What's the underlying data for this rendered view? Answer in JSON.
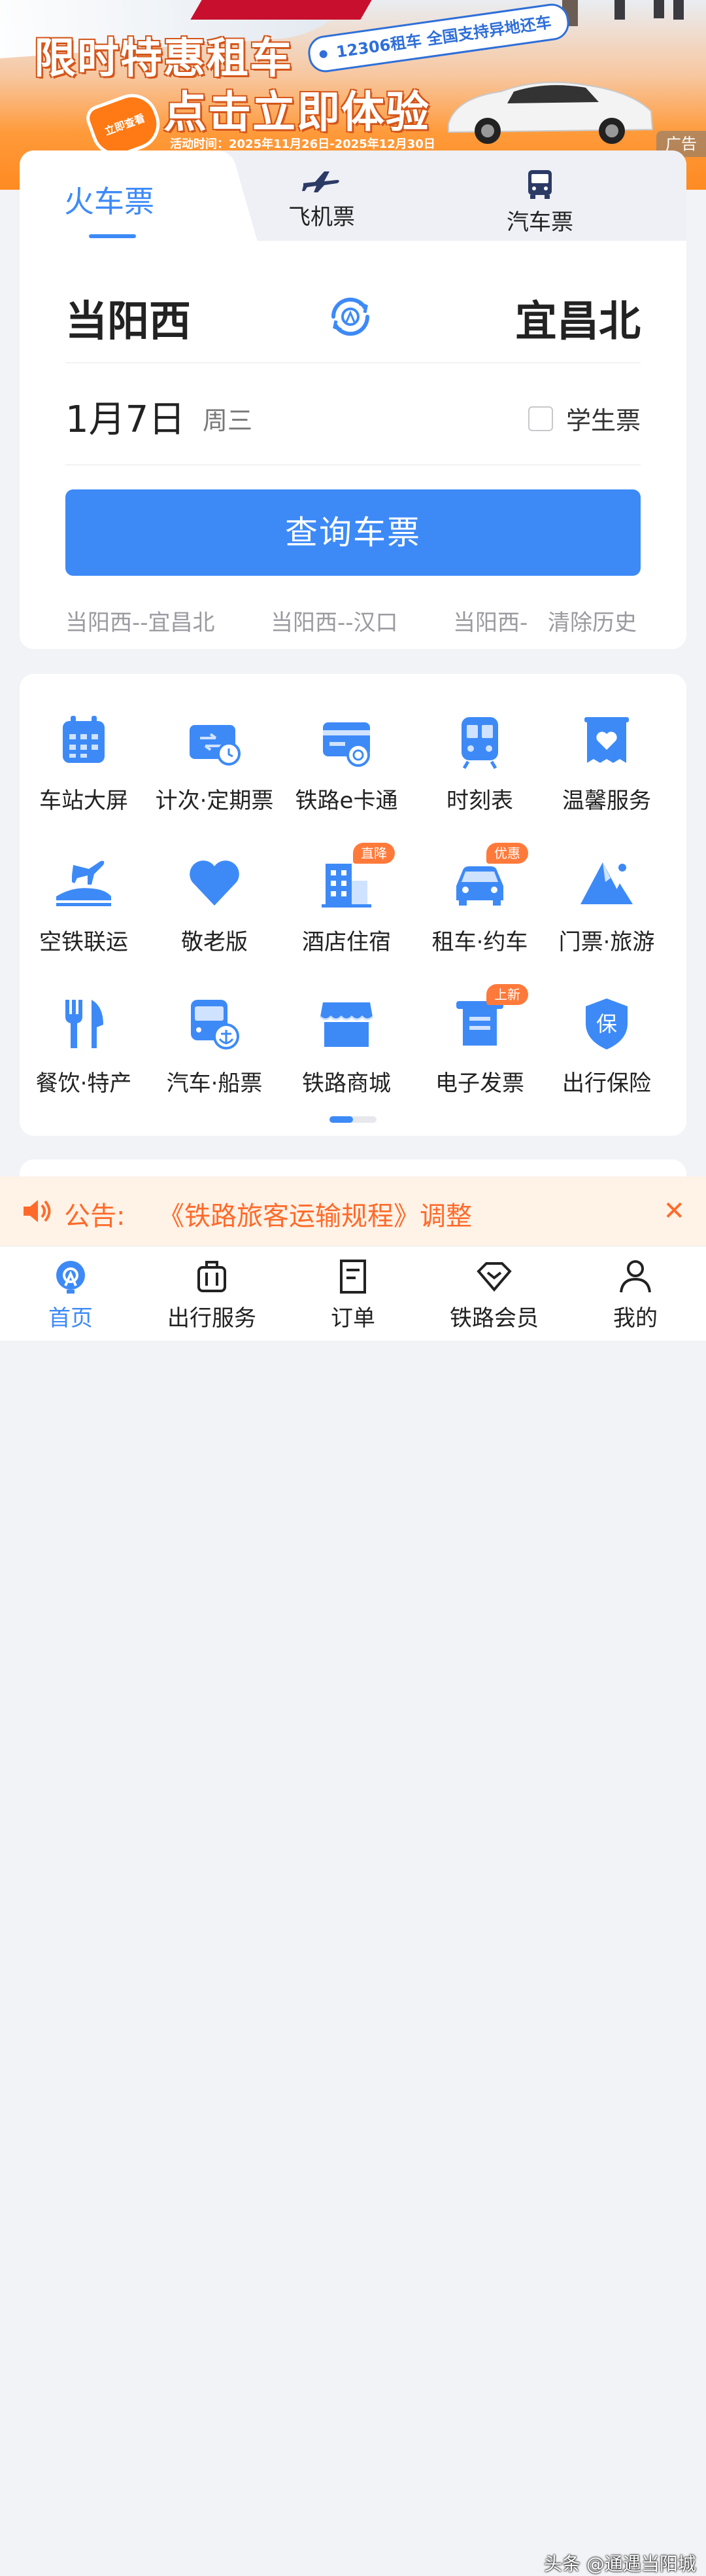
{
  "banner": {
    "title1": "限时特惠租车",
    "title2": "点击立即体验",
    "pill": "12306租车 全国支持异地还车",
    "hand": "立即查看",
    "activity": "活动时间：2025年11月26日-2025年12月30日",
    "ad": "广告"
  },
  "tabs": {
    "train": "火车票",
    "flight": "飞机票",
    "bus": "汽车票"
  },
  "route": {
    "from": "当阳西",
    "to": "宜昌北",
    "date": "1月7日",
    "weekday": "周三",
    "student": "学生票",
    "search": "查询车票",
    "history": [
      "当阳西--宜昌北",
      "当阳西--汉口",
      "当阳西-"
    ],
    "clear_history": "清除历史"
  },
  "services": [
    {
      "label": "车站大屏",
      "icon": "calendar-icon"
    },
    {
      "label": "计次·定期票",
      "icon": "ticket-clock-icon"
    },
    {
      "label": "铁路e卡通",
      "icon": "rail-card-icon"
    },
    {
      "label": "时刻表",
      "icon": "train-front-icon"
    },
    {
      "label": "温馨服务",
      "icon": "heart-box-icon"
    },
    {
      "label": "空铁联运",
      "icon": "plane-train-icon"
    },
    {
      "label": "敬老版",
      "icon": "heart-icon"
    },
    {
      "label": "酒店住宿",
      "icon": "hotel-icon",
      "badge": "直降"
    },
    {
      "label": "租车·约车",
      "icon": "car-icon",
      "badge": "优惠"
    },
    {
      "label": "门票·旅游",
      "icon": "mountain-icon"
    },
    {
      "label": "餐饮·特产",
      "icon": "fork-knife-icon"
    },
    {
      "label": "汽车·船票",
      "icon": "bus-anchor-icon"
    },
    {
      "label": "铁路商城",
      "icon": "shop-icon"
    },
    {
      "label": "电子发票",
      "icon": "invoice-icon",
      "badge": "上新"
    },
    {
      "label": "出行保险",
      "icon": "insurance-shield-icon"
    }
  ],
  "notice": {
    "label": "公告:",
    "text": "《铁路旅客运输规程》调整"
  },
  "nav": [
    {
      "label": "首页",
      "icon": "home-rail-icon",
      "active": true
    },
    {
      "label": "出行服务",
      "icon": "luggage-icon"
    },
    {
      "label": "订单",
      "icon": "order-icon"
    },
    {
      "label": "铁路会员",
      "icon": "diamond-icon"
    },
    {
      "label": "我的",
      "icon": "person-icon"
    }
  ],
  "watermark": "头条 @通遇当阳城",
  "colors": {
    "accent": "#3d8af7",
    "notice": "#ff6a2a",
    "banner": "#ff8a22"
  }
}
